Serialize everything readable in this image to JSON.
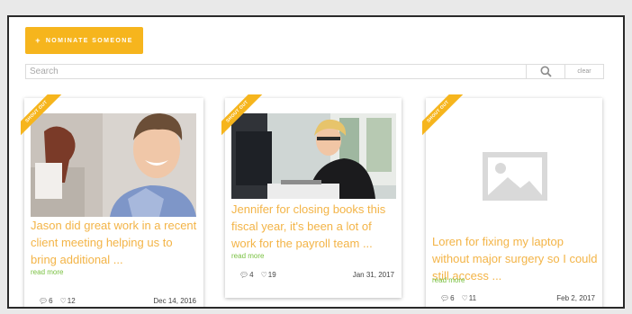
{
  "toolbar": {
    "nominate_label": "NOMINATE SOMEONE"
  },
  "search": {
    "placeholder": "Search",
    "clear_label": "clear"
  },
  "cards": [
    {
      "badge": "SHOUT OUT",
      "text": "Jason did great work in a recent client meeting helping us to bring additional ...",
      "read_more": "read more",
      "comments": "6",
      "likes": "12",
      "date": "Dec 14, 2016"
    },
    {
      "badge": "SHOUT OUT",
      "text": "Jennifer for closing books this fiscal year, it's been a lot of work for the payroll team ...",
      "read_more": "read more",
      "comments": "4",
      "likes": "19",
      "date": "Jan 31, 2017"
    },
    {
      "badge": "SHOUT OUT",
      "text": "Loren for fixing my laptop without major surgery so I could still access ...",
      "read_more": "read more",
      "comments": "6",
      "likes": "11",
      "date": "Feb 2, 2017"
    }
  ],
  "colors": {
    "accent": "#f6b51d",
    "text_accent": "#f3b447",
    "link": "#7ac142"
  }
}
